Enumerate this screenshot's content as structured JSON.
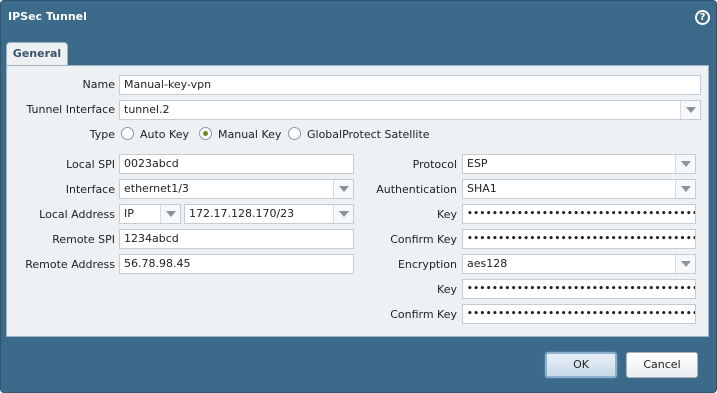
{
  "dialog": {
    "title": "IPSec Tunnel",
    "help_icon": "?"
  },
  "tabs": [
    {
      "label": "General"
    }
  ],
  "form": {
    "name": {
      "label": "Name",
      "value": "Manual-key-vpn"
    },
    "tunnel_interface": {
      "label": "Tunnel Interface",
      "value": "tunnel.2"
    },
    "type": {
      "label": "Type",
      "options": [
        "Auto Key",
        "Manual Key",
        "GlobalProtect Satellite"
      ],
      "selected": "Manual Key"
    },
    "local_spi": {
      "label": "Local SPI",
      "value": "0023abcd"
    },
    "interface": {
      "label": "Interface",
      "value": "ethernet1/3"
    },
    "local_address": {
      "label": "Local Address",
      "type_value": "IP",
      "value": "172.17.128.170/23"
    },
    "remote_spi": {
      "label": "Remote SPI",
      "value": "1234abcd"
    },
    "remote_address": {
      "label": "Remote Address",
      "value": "56.78.98.45"
    },
    "protocol": {
      "label": "Protocol",
      "value": "ESP"
    },
    "authentication": {
      "label": "Authentication",
      "value": "SHA1"
    },
    "auth_key": {
      "label": "Key",
      "value": "••••••••••••••••••••••••••••••••••••••••••••••"
    },
    "auth_confirm_key": {
      "label": "Confirm Key",
      "value": "••••••••••••••••••••••••••••••••••••••••••••••"
    },
    "encryption": {
      "label": "Encryption",
      "value": "aes128"
    },
    "enc_key": {
      "label": "Key",
      "value": "••••••••••••••••••••••••••••••••••••••••"
    },
    "enc_confirm_key": {
      "label": "Confirm Key",
      "value": "••••••••••••••••••••••••••••••••••••••••"
    }
  },
  "buttons": {
    "ok": "OK",
    "cancel": "Cancel"
  },
  "colors": {
    "frame": "#3b6a8a",
    "panel": "#eef1f4",
    "radio_selected": "#6b8e1e"
  }
}
